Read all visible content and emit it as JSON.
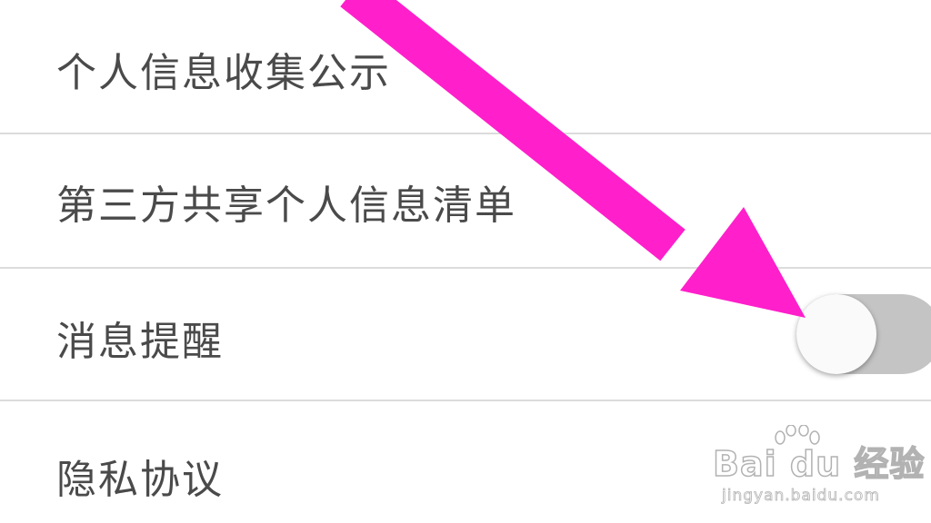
{
  "settings": {
    "items": [
      {
        "label": "个人信息收集公示"
      },
      {
        "label": "第三方共享个人信息清单"
      },
      {
        "label": "消息提醒",
        "toggle_on": false
      },
      {
        "label": "隐私协议"
      }
    ]
  },
  "annotation": {
    "arrow_color": "#ff1fcb",
    "arrow_target": "message-reminder-toggle"
  },
  "watermark": {
    "logo_text": "Bai du 经验",
    "url_text": "jingyan.baidu.com"
  },
  "colors": {
    "background": "#ffffff",
    "label_text": "#4a4a4a",
    "divider": "#dcdcdc",
    "toggle_track_off": "#c4c4c4",
    "toggle_knob": "#fafafa"
  }
}
